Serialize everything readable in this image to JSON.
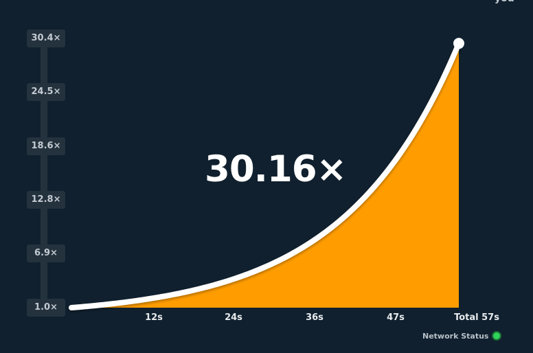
{
  "game": {
    "current_multiplier": "30.16×",
    "network_status_label": "Network Status",
    "network_status_color": "#2fd35a",
    "curve_fill_color": "#ff9d00",
    "curve_line_color": "#ffffff"
  },
  "chart_data": {
    "type": "area",
    "y_ticks": [
      "1.0×",
      "6.9×",
      "12.8×",
      "18.6×",
      "24.5×",
      "30.4×"
    ],
    "x_ticks": [
      "12s",
      "24s",
      "36s",
      "47s",
      "Total 57s"
    ],
    "x_tick_values": [
      12,
      24,
      36,
      47,
      57
    ],
    "y_tick_values": [
      1.0,
      6.9,
      12.8,
      18.6,
      24.5,
      30.4
    ],
    "xlim": [
      0,
      57
    ],
    "ylim": [
      1.0,
      30.4
    ],
    "end_point": {
      "x": 57,
      "y": 30.16
    }
  }
}
